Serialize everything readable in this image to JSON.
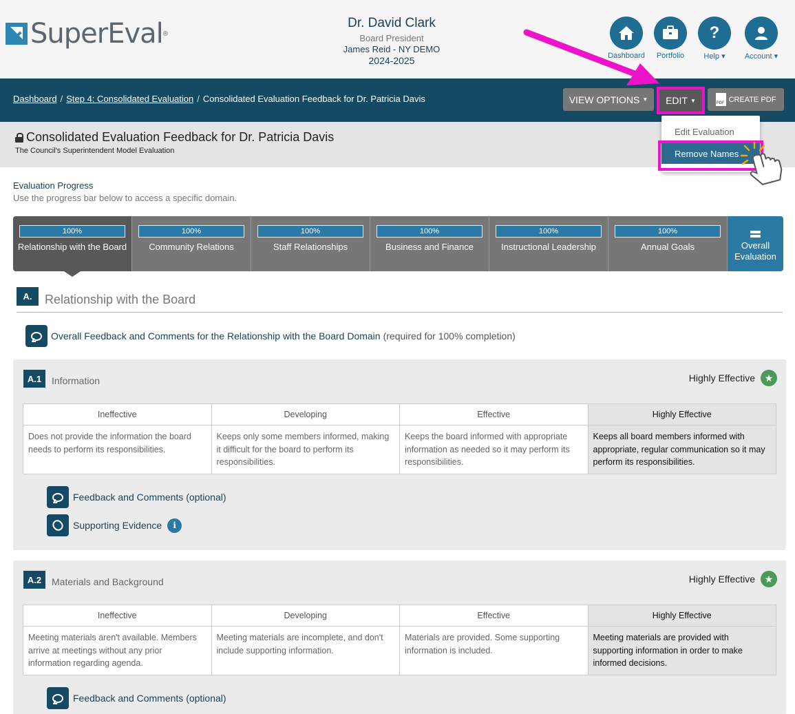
{
  "header": {
    "logo_text": "SuperEval",
    "logo_reg": "®",
    "user_name": "Dr. David Clark",
    "user_role": "Board President",
    "user_district": "James Reid - NY DEMO",
    "user_year": "2024-2025",
    "nav": [
      {
        "label": "Dashboard",
        "icon": "home-icon"
      },
      {
        "label": "Portfolio",
        "icon": "briefcase-icon"
      },
      {
        "label": "Help",
        "icon": "question-icon"
      },
      {
        "label": "Account",
        "icon": "user-icon"
      }
    ]
  },
  "breadcrumb": {
    "items": [
      "Dashboard",
      "Step 4: Consolidated Evaluation"
    ],
    "current": "Consolidated Evaluation Feedback for Dr. Patricia Davis",
    "separator": "/"
  },
  "toolbar": {
    "view_options": "VIEW OPTIONS",
    "edit": "EDIT",
    "create_pdf": "CREATE PDF"
  },
  "dropdown": {
    "edit_evaluation": "Edit Evaluation",
    "remove_names": "Remove Names"
  },
  "page": {
    "title": "Consolidated Evaluation Feedback for Dr. Patricia Davis",
    "subtitle": "The Council's Superintendent Model Evaluation"
  },
  "progress": {
    "title": "Evaluation Progress",
    "description": "Use the progress bar below to access a specific domain.",
    "tabs": [
      {
        "label": "Relationship with the Board",
        "percent": "100%"
      },
      {
        "label": "Community Relations",
        "percent": "100%"
      },
      {
        "label": "Staff Relationships",
        "percent": "100%"
      },
      {
        "label": "Business and Finance",
        "percent": "100%"
      },
      {
        "label": "Instructional Leadership",
        "percent": "100%"
      },
      {
        "label": "Annual Goals",
        "percent": "100%"
      }
    ],
    "overall_label": "Overall Evaluation"
  },
  "section": {
    "badge": "A.",
    "title": "Relationship with the Board",
    "overall_feedback_link": "Overall Feedback and Comments for the Relationship with the Board Domain",
    "overall_feedback_note": "(required for 100% completion)"
  },
  "rubric_headers": [
    "Ineffective",
    "Developing",
    "Effective",
    "Highly Effective"
  ],
  "indicators": [
    {
      "badge": "A.1",
      "title": "Information",
      "rating": "Highly Effective",
      "cells": [
        "Does not provide the information the board needs to perform its responsibilities.",
        "Keeps only some members informed, making it difficult for the board to perform its responsibilities.",
        "Keeps the board informed with appropriate information as needed so it may perform its responsibilities.",
        "Keeps all board members informed with appropriate, regular communication so it may perform its responsibilities."
      ],
      "feedback_link": "Feedback and Comments (optional)",
      "evidence_link": "Supporting Evidence"
    },
    {
      "badge": "A.2",
      "title": "Materials and Background",
      "rating": "Highly Effective",
      "cells": [
        "Meeting materials aren't available. Members arrive at meetings without any prior information regarding agenda.",
        "Meeting materials are incomplete, and don't include supporting information.",
        "Materials are provided. Some supporting information is included.",
        "Meeting materials are provided with supporting information in order to make informed decisions."
      ],
      "feedback_link": "Feedback and Comments (optional)"
    }
  ],
  "colors": {
    "brand_blue": "#1f6d93",
    "dark_navy": "#154a64",
    "highlight_magenta": "#ee12c8",
    "rating_green": "#4d9959"
  }
}
